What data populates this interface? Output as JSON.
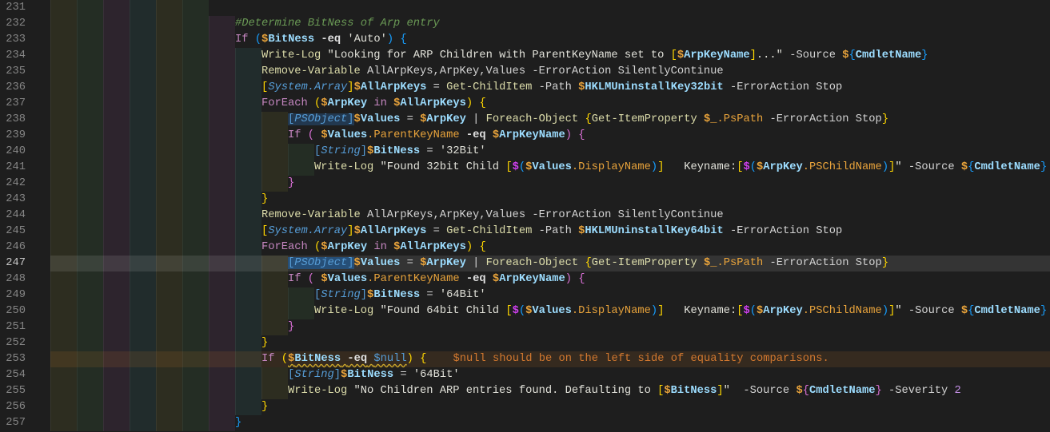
{
  "active_line": 247,
  "warning_line": 253,
  "lines": [
    {
      "num": "231",
      "indent": 6,
      "tokens": []
    },
    {
      "num": "232",
      "indent": 7,
      "tokens": [
        {
          "t": "#Determine BitNess of Arp entry",
          "c": "cm"
        }
      ]
    },
    {
      "num": "233",
      "indent": 7,
      "tokens": [
        {
          "t": "If",
          "c": "kw"
        },
        {
          "t": " ",
          "c": "pl"
        },
        {
          "t": "(",
          "c": "bb"
        },
        {
          "t": "$",
          "c": "d"
        },
        {
          "t": "BitNess",
          "c": "vn"
        },
        {
          "t": " ",
          "c": "pl"
        },
        {
          "t": "-eq",
          "c": "op"
        },
        {
          "t": " ",
          "c": "pl"
        },
        {
          "t": "'Auto'",
          "c": "str"
        },
        {
          "t": ")",
          "c": "bb"
        },
        {
          "t": " ",
          "c": "pl"
        },
        {
          "t": "{",
          "c": "bb"
        }
      ]
    },
    {
      "num": "234",
      "indent": 8,
      "tokens": [
        {
          "t": "Write-Log",
          "c": "cmd"
        },
        {
          "t": " ",
          "c": "pl"
        },
        {
          "t": "\"Looking for ARP Children with ParentKeyName set to ",
          "c": "str"
        },
        {
          "t": "[",
          "c": "bg"
        },
        {
          "t": "$",
          "c": "d"
        },
        {
          "t": "ArpKeyName",
          "c": "vn"
        },
        {
          "t": "]",
          "c": "bg"
        },
        {
          "t": "...\"",
          "c": "str"
        },
        {
          "t": " -Source ",
          "c": "pl"
        },
        {
          "t": "$",
          "c": "d"
        },
        {
          "t": "{",
          "c": "bb"
        },
        {
          "t": "CmdletName",
          "c": "vn"
        },
        {
          "t": "}",
          "c": "bb"
        }
      ]
    },
    {
      "num": "235",
      "indent": 8,
      "tokens": [
        {
          "t": "Remove-Variable",
          "c": "cmd"
        },
        {
          "t": " AllArpKeys,ArpKey,Values -ErrorAction SilentlyContinue",
          "c": "pl"
        }
      ]
    },
    {
      "num": "236",
      "indent": 8,
      "tokens": [
        {
          "t": "[",
          "c": "bg"
        },
        {
          "t": "System.Array",
          "c": "type"
        },
        {
          "t": "]",
          "c": "bg"
        },
        {
          "t": "$",
          "c": "d"
        },
        {
          "t": "AllArpKeys",
          "c": "vn"
        },
        {
          "t": " = ",
          "c": "pl"
        },
        {
          "t": "Get-ChildItem",
          "c": "cmd"
        },
        {
          "t": " -Path ",
          "c": "pl"
        },
        {
          "t": "$",
          "c": "d"
        },
        {
          "t": "HKLMUninstallKey32bit",
          "c": "vn"
        },
        {
          "t": " -ErrorAction Stop",
          "c": "pl"
        }
      ]
    },
    {
      "num": "237",
      "indent": 8,
      "tokens": [
        {
          "t": "ForEach",
          "c": "kw"
        },
        {
          "t": " ",
          "c": "pl"
        },
        {
          "t": "(",
          "c": "bg"
        },
        {
          "t": "$",
          "c": "d"
        },
        {
          "t": "ArpKey",
          "c": "vn"
        },
        {
          "t": " ",
          "c": "pl"
        },
        {
          "t": "in",
          "c": "kw"
        },
        {
          "t": " ",
          "c": "pl"
        },
        {
          "t": "$",
          "c": "d"
        },
        {
          "t": "AllArpKeys",
          "c": "vn"
        },
        {
          "t": ")",
          "c": "bg"
        },
        {
          "t": " ",
          "c": "pl"
        },
        {
          "t": "{",
          "c": "bg"
        }
      ]
    },
    {
      "num": "238",
      "indent": 9,
      "tokens": [
        {
          "t": "[",
          "c": "tb hl2"
        },
        {
          "t": "PSObject",
          "c": "type hl2"
        },
        {
          "t": "]",
          "c": "tb hl2"
        },
        {
          "t": "$",
          "c": "d"
        },
        {
          "t": "Values",
          "c": "vn"
        },
        {
          "t": " = ",
          "c": "pl"
        },
        {
          "t": "$",
          "c": "d"
        },
        {
          "t": "ArpKey",
          "c": "vn"
        },
        {
          "t": " | ",
          "c": "pl"
        },
        {
          "t": "Foreach-Object",
          "c": "cmd"
        },
        {
          "t": " ",
          "c": "pl"
        },
        {
          "t": "{",
          "c": "bg"
        },
        {
          "t": "Get-ItemProperty",
          "c": "cmd"
        },
        {
          "t": " ",
          "c": "pl"
        },
        {
          "t": "$_",
          "c": "d"
        },
        {
          "t": ".PsPath",
          "c": "prop"
        },
        {
          "t": " -ErrorAction Stop",
          "c": "pl"
        },
        {
          "t": "}",
          "c": "bg"
        }
      ]
    },
    {
      "num": "239",
      "indent": 9,
      "tokens": [
        {
          "t": "If",
          "c": "kw"
        },
        {
          "t": " ",
          "c": "pl"
        },
        {
          "t": "(",
          "c": "bp"
        },
        {
          "t": " ",
          "c": "pl"
        },
        {
          "t": "$",
          "c": "d"
        },
        {
          "t": "Values",
          "c": "vn"
        },
        {
          "t": ".ParentKeyName",
          "c": "prop"
        },
        {
          "t": " ",
          "c": "pl"
        },
        {
          "t": "-eq",
          "c": "op"
        },
        {
          "t": " ",
          "c": "pl"
        },
        {
          "t": "$",
          "c": "d"
        },
        {
          "t": "ArpKeyName",
          "c": "vn"
        },
        {
          "t": ")",
          "c": "bp"
        },
        {
          "t": " ",
          "c": "pl"
        },
        {
          "t": "{",
          "c": "bp"
        }
      ]
    },
    {
      "num": "240",
      "indent": 10,
      "tokens": [
        {
          "t": "[",
          "c": "tb"
        },
        {
          "t": "String",
          "c": "type"
        },
        {
          "t": "]",
          "c": "tb"
        },
        {
          "t": "$",
          "c": "d"
        },
        {
          "t": "BitNess",
          "c": "vn"
        },
        {
          "t": " = ",
          "c": "pl"
        },
        {
          "t": "'32Bit'",
          "c": "str"
        }
      ]
    },
    {
      "num": "241",
      "indent": 10,
      "tokens": [
        {
          "t": "Write-Log",
          "c": "cmd"
        },
        {
          "t": " ",
          "c": "pl"
        },
        {
          "t": "\"Found 32bit Child ",
          "c": "str"
        },
        {
          "t": "[",
          "c": "bg"
        },
        {
          "t": "$",
          "c": "bm"
        },
        {
          "t": "(",
          "c": "bb"
        },
        {
          "t": "$",
          "c": "d"
        },
        {
          "t": "Values",
          "c": "vn"
        },
        {
          "t": ".DisplayName",
          "c": "prop"
        },
        {
          "t": ")",
          "c": "bb"
        },
        {
          "t": "]",
          "c": "bg"
        },
        {
          "t": "   Keyname:",
          "c": "str"
        },
        {
          "t": "[",
          "c": "bg"
        },
        {
          "t": "$",
          "c": "bm"
        },
        {
          "t": "(",
          "c": "bb"
        },
        {
          "t": "$",
          "c": "d"
        },
        {
          "t": "ArpKey",
          "c": "vn"
        },
        {
          "t": ".PSChildName",
          "c": "prop"
        },
        {
          "t": ")",
          "c": "bb"
        },
        {
          "t": "]",
          "c": "bg"
        },
        {
          "t": "\"",
          "c": "str"
        },
        {
          "t": " -Source ",
          "c": "pl"
        },
        {
          "t": "$",
          "c": "d"
        },
        {
          "t": "{",
          "c": "bb"
        },
        {
          "t": "CmdletName",
          "c": "vn"
        },
        {
          "t": "}",
          "c": "bb"
        }
      ]
    },
    {
      "num": "242",
      "indent": 9,
      "tokens": [
        {
          "t": "}",
          "c": "bp"
        }
      ]
    },
    {
      "num": "243",
      "indent": 8,
      "tokens": [
        {
          "t": "}",
          "c": "bg"
        }
      ]
    },
    {
      "num": "244",
      "indent": 8,
      "tokens": [
        {
          "t": "Remove-Variable",
          "c": "cmd"
        },
        {
          "t": " AllArpKeys,ArpKey,Values -ErrorAction SilentlyContinue",
          "c": "pl"
        }
      ]
    },
    {
      "num": "245",
      "indent": 8,
      "tokens": [
        {
          "t": "[",
          "c": "bg"
        },
        {
          "t": "System.Array",
          "c": "type"
        },
        {
          "t": "]",
          "c": "bg"
        },
        {
          "t": "$",
          "c": "d"
        },
        {
          "t": "AllArpKeys",
          "c": "vn"
        },
        {
          "t": " = ",
          "c": "pl"
        },
        {
          "t": "Get-ChildItem",
          "c": "cmd"
        },
        {
          "t": " -Path ",
          "c": "pl"
        },
        {
          "t": "$",
          "c": "d"
        },
        {
          "t": "HKLMUninstallKey64bit",
          "c": "vn"
        },
        {
          "t": " -ErrorAction Stop",
          "c": "pl"
        }
      ]
    },
    {
      "num": "246",
      "indent": 8,
      "tokens": [
        {
          "t": "ForEach",
          "c": "kw"
        },
        {
          "t": " ",
          "c": "pl"
        },
        {
          "t": "(",
          "c": "bg"
        },
        {
          "t": "$",
          "c": "d"
        },
        {
          "t": "ArpKey",
          "c": "vn"
        },
        {
          "t": " ",
          "c": "pl"
        },
        {
          "t": "in",
          "c": "kw"
        },
        {
          "t": " ",
          "c": "pl"
        },
        {
          "t": "$",
          "c": "d"
        },
        {
          "t": "AllArpKeys",
          "c": "vn"
        },
        {
          "t": ")",
          "c": "bg"
        },
        {
          "t": " ",
          "c": "pl"
        },
        {
          "t": "{",
          "c": "bg"
        }
      ]
    },
    {
      "num": "247",
      "indent": 9,
      "tokens": [
        {
          "t": "[",
          "c": "tb hl"
        },
        {
          "t": "PSObject",
          "c": "type hl"
        },
        {
          "t": "]",
          "c": "tb hl"
        },
        {
          "t": "$",
          "c": "d"
        },
        {
          "t": "Values",
          "c": "vn"
        },
        {
          "t": " = ",
          "c": "pl"
        },
        {
          "t": "$",
          "c": "d"
        },
        {
          "t": "ArpKey",
          "c": "vn"
        },
        {
          "t": " | ",
          "c": "pl"
        },
        {
          "t": "Foreach-Object",
          "c": "cmd"
        },
        {
          "t": " ",
          "c": "pl"
        },
        {
          "t": "{",
          "c": "bg"
        },
        {
          "t": "Get-ItemProperty",
          "c": "cmd"
        },
        {
          "t": " ",
          "c": "pl"
        },
        {
          "t": "$_",
          "c": "d"
        },
        {
          "t": ".PsPath",
          "c": "prop"
        },
        {
          "t": " -ErrorAction Stop",
          "c": "pl"
        },
        {
          "t": "}",
          "c": "bg"
        }
      ]
    },
    {
      "num": "248",
      "indent": 9,
      "tokens": [
        {
          "t": "If",
          "c": "kw"
        },
        {
          "t": " ",
          "c": "pl"
        },
        {
          "t": "(",
          "c": "bp"
        },
        {
          "t": " ",
          "c": "pl"
        },
        {
          "t": "$",
          "c": "d"
        },
        {
          "t": "Values",
          "c": "vn"
        },
        {
          "t": ".ParentKeyName",
          "c": "prop"
        },
        {
          "t": " ",
          "c": "pl"
        },
        {
          "t": "-eq",
          "c": "op"
        },
        {
          "t": " ",
          "c": "pl"
        },
        {
          "t": "$",
          "c": "d"
        },
        {
          "t": "ArpKeyName",
          "c": "vn"
        },
        {
          "t": ")",
          "c": "bp"
        },
        {
          "t": " ",
          "c": "pl"
        },
        {
          "t": "{",
          "c": "bp"
        }
      ]
    },
    {
      "num": "249",
      "indent": 10,
      "tokens": [
        {
          "t": "[",
          "c": "tb"
        },
        {
          "t": "String",
          "c": "type"
        },
        {
          "t": "]",
          "c": "tb"
        },
        {
          "t": "$",
          "c": "d"
        },
        {
          "t": "BitNess",
          "c": "vn"
        },
        {
          "t": " = ",
          "c": "pl"
        },
        {
          "t": "'64Bit'",
          "c": "str"
        }
      ]
    },
    {
      "num": "250",
      "indent": 10,
      "tokens": [
        {
          "t": "Write-Log",
          "c": "cmd"
        },
        {
          "t": " ",
          "c": "pl"
        },
        {
          "t": "\"Found 64bit Child ",
          "c": "str"
        },
        {
          "t": "[",
          "c": "bg"
        },
        {
          "t": "$",
          "c": "bm"
        },
        {
          "t": "(",
          "c": "bb"
        },
        {
          "t": "$",
          "c": "d"
        },
        {
          "t": "Values",
          "c": "vn"
        },
        {
          "t": ".DisplayName",
          "c": "prop"
        },
        {
          "t": ")",
          "c": "bb"
        },
        {
          "t": "]",
          "c": "bg"
        },
        {
          "t": "   Keyname:",
          "c": "str"
        },
        {
          "t": "[",
          "c": "bg"
        },
        {
          "t": "$",
          "c": "bm"
        },
        {
          "t": "(",
          "c": "bb"
        },
        {
          "t": "$",
          "c": "d"
        },
        {
          "t": "ArpKey",
          "c": "vn"
        },
        {
          "t": ".PSChildName",
          "c": "prop"
        },
        {
          "t": ")",
          "c": "bb"
        },
        {
          "t": "]",
          "c": "bg"
        },
        {
          "t": "\"",
          "c": "str"
        },
        {
          "t": " -Source ",
          "c": "pl"
        },
        {
          "t": "$",
          "c": "d"
        },
        {
          "t": "{",
          "c": "bb"
        },
        {
          "t": "CmdletName",
          "c": "vn"
        },
        {
          "t": "}",
          "c": "bb"
        }
      ]
    },
    {
      "num": "251",
      "indent": 9,
      "tokens": [
        {
          "t": "}",
          "c": "bp"
        }
      ]
    },
    {
      "num": "252",
      "indent": 8,
      "tokens": [
        {
          "t": "}",
          "c": "bg"
        }
      ]
    },
    {
      "num": "253",
      "indent": 8,
      "tokens": [
        {
          "t": "If",
          "c": "kw"
        },
        {
          "t": " ",
          "c": "pl"
        },
        {
          "t": "(",
          "c": "bg"
        },
        {
          "t": "$",
          "c": "d sq"
        },
        {
          "t": "BitNess",
          "c": "vn sq"
        },
        {
          "t": " ",
          "c": "pl sq"
        },
        {
          "t": "-eq",
          "c": "op sq"
        },
        {
          "t": " ",
          "c": "pl sq"
        },
        {
          "t": "$null",
          "c": "nul sq"
        },
        {
          "t": ")",
          "c": "bg"
        },
        {
          "t": " ",
          "c": "pl"
        },
        {
          "t": "{",
          "c": "bg"
        },
        {
          "t": "    $null should be on the left side of equality comparisons.",
          "c": "warn"
        }
      ]
    },
    {
      "num": "254",
      "indent": 9,
      "tokens": [
        {
          "t": "[",
          "c": "tb"
        },
        {
          "t": "String",
          "c": "type"
        },
        {
          "t": "]",
          "c": "tb"
        },
        {
          "t": "$",
          "c": "d"
        },
        {
          "t": "BitNess",
          "c": "vn"
        },
        {
          "t": " = ",
          "c": "pl"
        },
        {
          "t": "'64Bit'",
          "c": "str"
        }
      ]
    },
    {
      "num": "255",
      "indent": 9,
      "tokens": [
        {
          "t": "Write-Log",
          "c": "cmd"
        },
        {
          "t": " ",
          "c": "pl"
        },
        {
          "t": "\"No Children ARP entries found. Defaulting to ",
          "c": "str"
        },
        {
          "t": "[",
          "c": "bg"
        },
        {
          "t": "$",
          "c": "d"
        },
        {
          "t": "BitNess",
          "c": "vn"
        },
        {
          "t": "]",
          "c": "bg"
        },
        {
          "t": "\"",
          "c": "str"
        },
        {
          "t": "  -Source ",
          "c": "pl"
        },
        {
          "t": "$",
          "c": "d"
        },
        {
          "t": "{",
          "c": "bp"
        },
        {
          "t": "CmdletName",
          "c": "vn"
        },
        {
          "t": "}",
          "c": "bp"
        },
        {
          "t": " -Severity ",
          "c": "pl"
        },
        {
          "t": "2",
          "c": "num"
        }
      ]
    },
    {
      "num": "256",
      "indent": 8,
      "tokens": [
        {
          "t": "}",
          "c": "bg"
        }
      ]
    },
    {
      "num": "257",
      "indent": 7,
      "tokens": [
        {
          "t": "}",
          "c": "bb"
        }
      ]
    }
  ]
}
